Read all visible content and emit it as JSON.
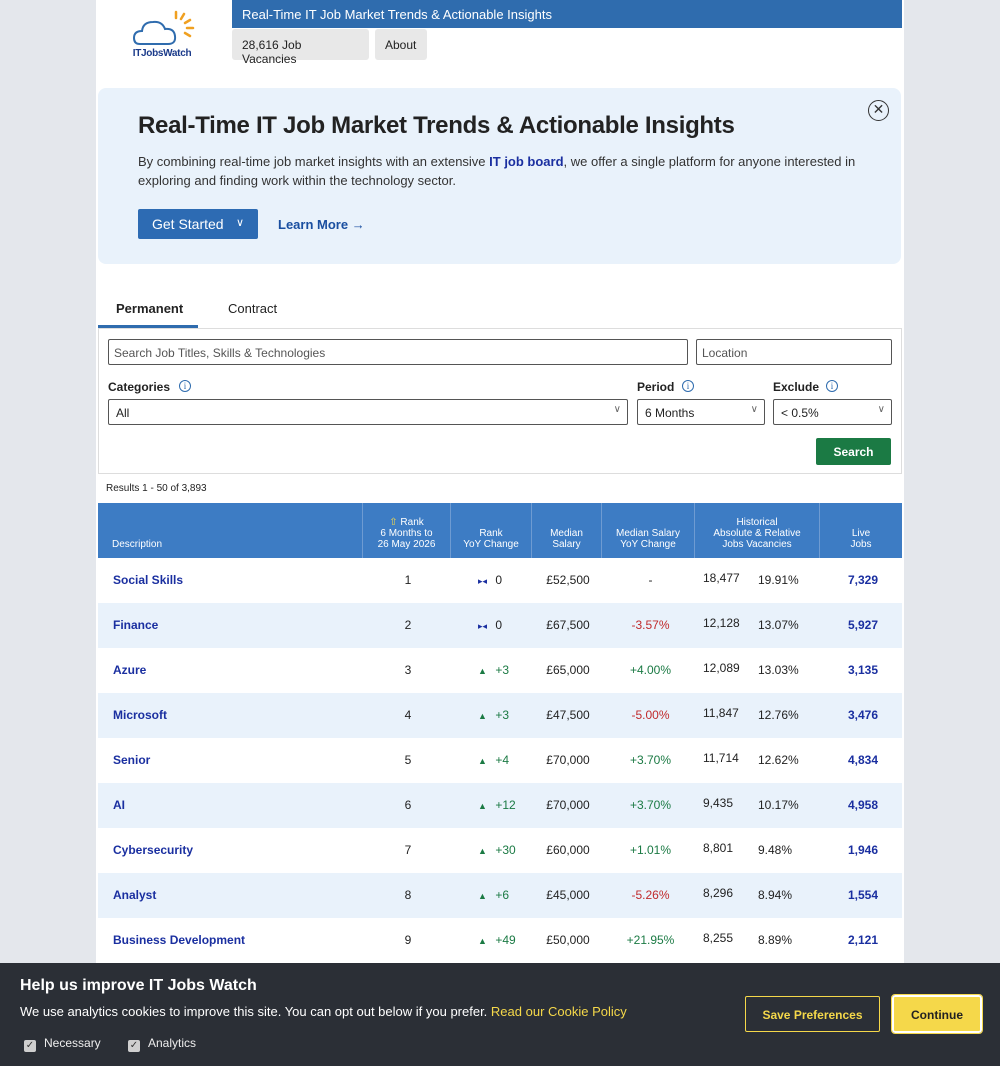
{
  "header": {
    "logo_text": "ITJobsWatch",
    "title_bar": "Real-Time IT Job Market Trends & Actionable Insights",
    "nav": [
      "28,616 Job Vacancies",
      "About"
    ]
  },
  "hero": {
    "title": "Real-Time IT Job Market Trends & Actionable Insights",
    "text_before": "By combining real-time job market insights with an extensive ",
    "link": "IT job board",
    "text_after": ", we offer a single platform for anyone interested in exploring and finding work within the technology sector.",
    "get_started": "Get Started",
    "learn_more": "Learn More"
  },
  "tabs": [
    "Permanent",
    "Contract"
  ],
  "search": {
    "job_placeholder": "Search Job Titles, Skills & Technologies",
    "location_placeholder": "Location",
    "categories_label": "Categories",
    "categories_value": "All",
    "period_label": "Period",
    "period_value": "6 Months",
    "exclude_label": "Exclude",
    "exclude_value": "< 0.5%",
    "button": "Search"
  },
  "results_text": "Results 1 - 50 of 3,893",
  "table": {
    "headers": {
      "description": "Description",
      "rank_top": "Rank",
      "rank_period": "6 Months to",
      "rank_date": "26 May 2026",
      "rank_yoy_1": "Rank",
      "rank_yoy_2": "YoY Change",
      "median_1": "Median",
      "median_2": "Salary",
      "msyoy_1": "Median Salary",
      "msyoy_2": "YoY Change",
      "hist_1": "Historical",
      "hist_2": "Absolute & Relative",
      "hist_3": "Jobs Vacancies",
      "live_1": "Live",
      "live_2": "Jobs"
    },
    "rows": [
      {
        "desc": "Social Skills",
        "rank": "1",
        "rank_chg": "0",
        "trend": "flat",
        "salary": "£52,500",
        "sal_chg": "-",
        "sal_dir": "none",
        "hist": "18,477",
        "pct": "19.91%",
        "live": "7,329"
      },
      {
        "desc": "Finance",
        "rank": "2",
        "rank_chg": "0",
        "trend": "flat",
        "salary": "£67,500",
        "sal_chg": "-3.57%",
        "sal_dir": "neg",
        "hist": "12,128",
        "pct": "13.07%",
        "live": "5,927"
      },
      {
        "desc": "Azure",
        "rank": "3",
        "rank_chg": "+3",
        "trend": "up",
        "salary": "£65,000",
        "sal_chg": "+4.00%",
        "sal_dir": "pos",
        "hist": "12,089",
        "pct": "13.03%",
        "live": "3,135"
      },
      {
        "desc": "Microsoft",
        "rank": "4",
        "rank_chg": "+3",
        "trend": "up",
        "salary": "£47,500",
        "sal_chg": "-5.00%",
        "sal_dir": "neg",
        "hist": "11,847",
        "pct": "12.76%",
        "live": "3,476"
      },
      {
        "desc": "Senior",
        "rank": "5",
        "rank_chg": "+4",
        "trend": "up",
        "salary": "£70,000",
        "sal_chg": "+3.70%",
        "sal_dir": "pos",
        "hist": "11,714",
        "pct": "12.62%",
        "live": "4,834"
      },
      {
        "desc": "AI",
        "rank": "6",
        "rank_chg": "+12",
        "trend": "up",
        "salary": "£70,000",
        "sal_chg": "+3.70%",
        "sal_dir": "pos",
        "hist": "9,435",
        "pct": "10.17%",
        "live": "4,958"
      },
      {
        "desc": "Cybersecurity",
        "rank": "7",
        "rank_chg": "+30",
        "trend": "up",
        "salary": "£60,000",
        "sal_chg": "+1.01%",
        "sal_dir": "pos",
        "hist": "8,801",
        "pct": "9.48%",
        "live": "1,946"
      },
      {
        "desc": "Analyst",
        "rank": "8",
        "rank_chg": "+6",
        "trend": "up",
        "salary": "£45,000",
        "sal_chg": "-5.26%",
        "sal_dir": "neg",
        "hist": "8,296",
        "pct": "8.94%",
        "live": "1,554"
      },
      {
        "desc": "Business Development",
        "rank": "9",
        "rank_chg": "+49",
        "trend": "up",
        "salary": "£50,000",
        "sal_chg": "+21.95%",
        "sal_dir": "pos",
        "hist": "8,255",
        "pct": "8.89%",
        "live": "2,121"
      }
    ]
  },
  "cookie": {
    "title": "Help us improve IT Jobs Watch",
    "message": "We use analytics cookies to improve this site. You can opt out below if you prefer. ",
    "policy_link": "Read our Cookie Policy",
    "necessary": "Necessary",
    "analytics": "Analytics",
    "save": "Save Preferences",
    "continue": "Continue"
  },
  "colors": {
    "brand_blue": "#2f6cae",
    "table_header": "#3d7cc4",
    "link": "#1a2fa0",
    "positive": "#1b7a44",
    "negative": "#c0292b",
    "cookie_accent": "#f5d84a"
  }
}
